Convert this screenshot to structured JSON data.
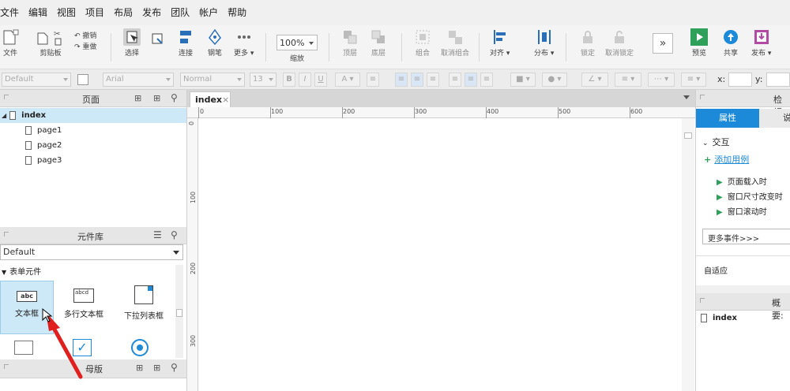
{
  "menu": [
    "文件",
    "编辑",
    "视图",
    "项目",
    "布局",
    "发布",
    "团队",
    "帐户",
    "帮助"
  ],
  "toolbar": {
    "file": "文件",
    "clipboard": "剪贴板",
    "undo": "撤销",
    "redo": "重做",
    "select": "选择",
    "connect": "连接",
    "pen": "钢笔",
    "more": "更多 ▾",
    "zoom_value": "100%",
    "zoom_label": "缩放",
    "top": "顶层",
    "bottom": "底层",
    "group": "组合",
    "ungroup": "取消组合",
    "align": "对齐 ▾",
    "distribute": "分布 ▾",
    "lock": "锁定",
    "unlock": "取消锁定",
    "preview": "预览",
    "share": "共享",
    "publish": "发布 ▾"
  },
  "format": {
    "style": "Default",
    "font": "Arial",
    "weight": "Normal",
    "size": "13",
    "x_label": "x:",
    "y_label": "y:"
  },
  "pages_panel": {
    "title": "页面",
    "root": "index",
    "children": [
      "page1",
      "page2",
      "page3"
    ]
  },
  "library_panel": {
    "title": "元件库",
    "selected": "Default",
    "group": "表单元件",
    "widget_textbox": "文本框",
    "widget_textbox_icon": "abc",
    "widget_textarea": "多行文本框",
    "widget_textarea_icon": "abcd",
    "widget_dropdown": "下拉列表框"
  },
  "master_panel": {
    "title": "母版"
  },
  "canvas": {
    "tab": "index",
    "ruler_h": [
      "0",
      "100",
      "200",
      "300",
      "400",
      "500",
      "600"
    ],
    "ruler_v": [
      "0",
      "100",
      "200",
      "300"
    ]
  },
  "inspector": {
    "title": "检视:",
    "tab_props": "属性",
    "tab_notes": "说",
    "section_interaction": "交互",
    "add_case": "添加用例",
    "events": [
      "页面载入时",
      "窗口尺寸改变时",
      "窗口滚动时"
    ],
    "more_events": "更多事件>>>",
    "adaptive": "自适应"
  },
  "outline": {
    "title": "概要:",
    "item": "index"
  },
  "colors": {
    "accent_blue": "#1c8ad8",
    "selection": "#cde8f6",
    "green": "#2fa05a",
    "arrow_red": "#e0201e"
  }
}
